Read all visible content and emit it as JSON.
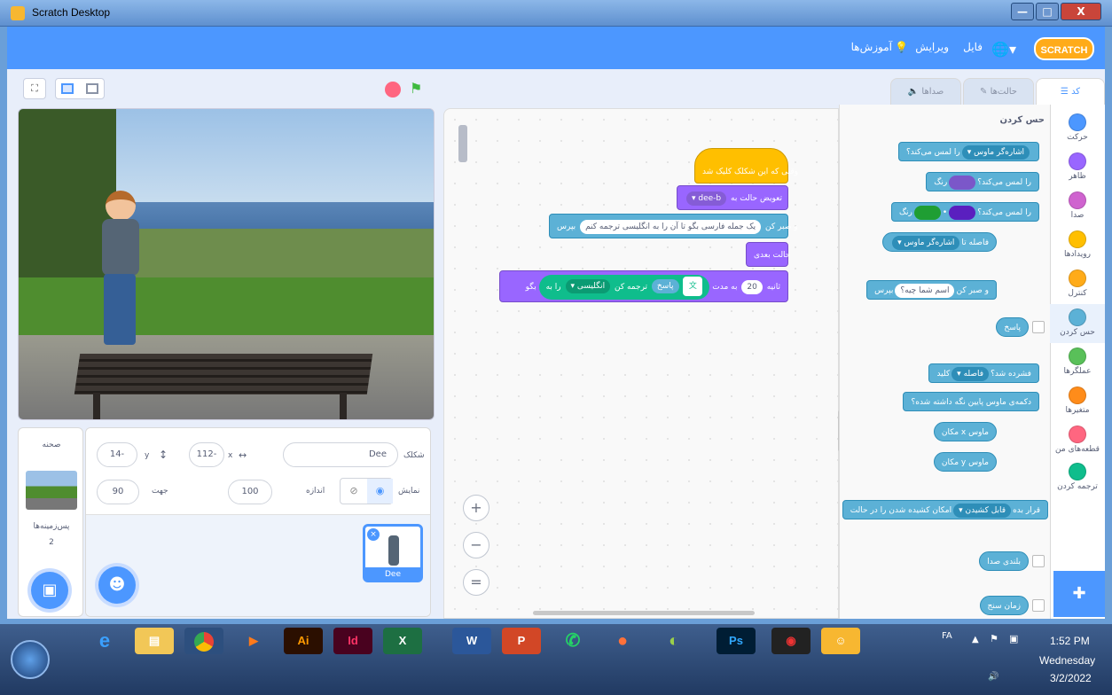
{
  "window": {
    "title": "Scratch Desktop",
    "minimize": "—",
    "maximize": "□",
    "close": "X"
  },
  "menu": {
    "logo": "SCRATCH",
    "file": "فایل",
    "edit": "ویرایش",
    "tutorials": "آموزش‌ها"
  },
  "tabs": {
    "code": "کد",
    "costumes": "حالت‌ها",
    "sounds": "صداها"
  },
  "categories": [
    {
      "label": "حرکت",
      "color": "#4c97ff"
    },
    {
      "label": "ظاهر",
      "color": "#9966ff"
    },
    {
      "label": "صدا",
      "color": "#cf63cf"
    },
    {
      "label": "رویدادها",
      "color": "#ffbf00"
    },
    {
      "label": "کنترل",
      "color": "#ffab19"
    },
    {
      "label": "حس کردن",
      "color": "#5cb1d6"
    },
    {
      "label": "عملگرها",
      "color": "#59c059"
    },
    {
      "label": "متغیرها",
      "color": "#ff8c1a"
    },
    {
      "label": "قطعه‌های من",
      "color": "#ff6680"
    },
    {
      "label": "ترجمه کردن",
      "color": "#0fbd8c"
    }
  ],
  "palette": {
    "title": "حس کردن",
    "touching": "را لمس می‌کند؟",
    "mouse_pointer": "اشاره‌گر ماوس",
    "color": "رنگ",
    "color_touching_color": "را لمس می‌کند؟",
    "distance_to": "فاصله تا",
    "ask": "بپرس",
    "ask_default": "اسم شما چیه؟",
    "and_wait": "و صبر کن",
    "answer": "پاسخ",
    "key": "کلید",
    "key_space": "فاصله",
    "pressed": "فشرده شد؟",
    "mouse_down": "دکمه‌ی ماوس پایین نگه داشته شده؟",
    "mouse_x": "مکان x ماوس",
    "mouse_y": "مکان y ماوس",
    "set_drag": "امکان کشیده شدن را در حالت",
    "draggable": "قابل کشیدن",
    "set_to": "قرار بده",
    "loudness": "بلندی صدا",
    "timer": "زمان سنج"
  },
  "script": {
    "hat": "وقتی که این شکلک کلیک شد",
    "switch_costume": "تعویض حالت به",
    "costume_name": "dee-b",
    "ask": "بپرس",
    "ask_text": "یک جمله فارسی بگو تا آن را به انگلیسی ترجمه کنم",
    "and_wait": "و صبر کن",
    "next_costume": "حالت بعدی",
    "say": "بگو",
    "answer": "پاسخ",
    "to": "را به",
    "language": "انگلیسی",
    "translate": "ترجمه کن",
    "for": "به مدت",
    "seconds_value": "20",
    "seconds": "ثانیه"
  },
  "zoom": {
    "in": "+",
    "out": "−",
    "reset": "="
  },
  "sprite": {
    "sprite_label": "شکلک",
    "name": "Dee",
    "x_label": "x",
    "x_value": "112-",
    "y_label": "y",
    "y_value": "14-",
    "show_label": "نمایش",
    "size_label": "اندازه",
    "size_value": "100",
    "direction_label": "جهت",
    "direction_value": "90",
    "thumb_name": "Dee"
  },
  "stage_pane": {
    "title": "صحنه",
    "backdrops_label": "پس‌زمینه‌ها",
    "backdrops_count": "2"
  },
  "taskbar": {
    "lang": "FA",
    "time": "1:52 PM",
    "day": "Wednesday",
    "date": "3/2/2022",
    "apps": [
      "Ai",
      "Id",
      "X",
      "W",
      "P",
      "Ps"
    ]
  }
}
